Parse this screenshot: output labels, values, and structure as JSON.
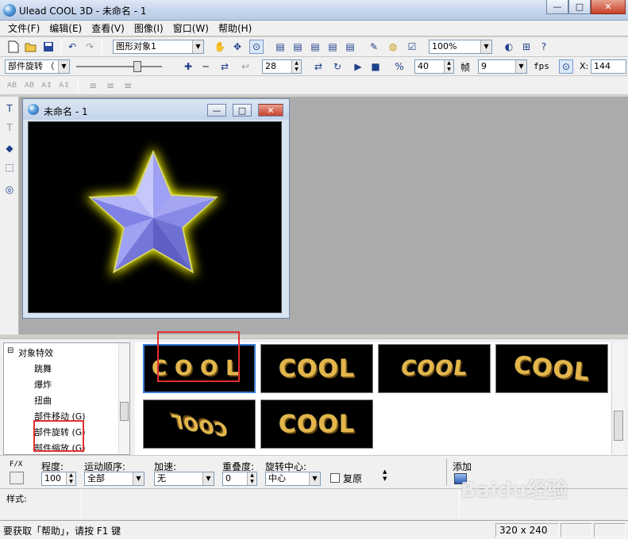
{
  "window": {
    "title": "Ulead COOL 3D - 未命名 - 1",
    "min_glyph": "—",
    "max_glyph": "□",
    "close_glyph": "✕"
  },
  "menu": [
    "文件(F)",
    "编辑(E)",
    "查看(V)",
    "图像(I)",
    "窗口(W)",
    "帮助(H)"
  ],
  "toolbar1": {
    "object_combo": "图形对象1",
    "zoom_combo": "100%"
  },
  "toolbar2": {
    "effect_combo": "部件旋转 （",
    "frame_value": "28",
    "total_frames": "40",
    "frame_label": "帧",
    "fps_value": "9",
    "fps_label": "fps",
    "x_label": "X:",
    "x_value": "144"
  },
  "toolbar3": {
    "text_buttons": [
      "AB",
      "AB",
      "A↕",
      "A↕"
    ]
  },
  "document": {
    "title": "未命名 - 1"
  },
  "tree": {
    "root": "对象特效",
    "items": [
      "跳舞",
      "爆炸",
      "扭曲",
      "部件移动 (G)",
      "部件旋转 (G)",
      "部件缩放 (G)"
    ]
  },
  "thumbnails": [
    "COOL",
    "COOL",
    "COOL",
    "COOL",
    "COOL",
    "COOL"
  ],
  "properties": {
    "fx_label": "F/X",
    "degree_label": "程度:",
    "degree_value": "100",
    "motion_order_label": "运动顺序:",
    "motion_order_value": "全部",
    "accel_label": "加速:",
    "accel_value": "无",
    "overlap_label": "重叠度:",
    "overlap_value": "0",
    "rotation_center_label": "旋转中心:",
    "rotation_center_value": "中心",
    "reset_label": "复原",
    "add_label": "添加"
  },
  "style": {
    "label": "样式:"
  },
  "status": {
    "help_text": "要获取「帮助」，请按 F1 键",
    "size_text": "320 x 240"
  },
  "watermark": "Baidu经验",
  "colors": {
    "star_fill": "#8c8ef0",
    "glow": "#ffff00",
    "highlight": "#e03030"
  }
}
